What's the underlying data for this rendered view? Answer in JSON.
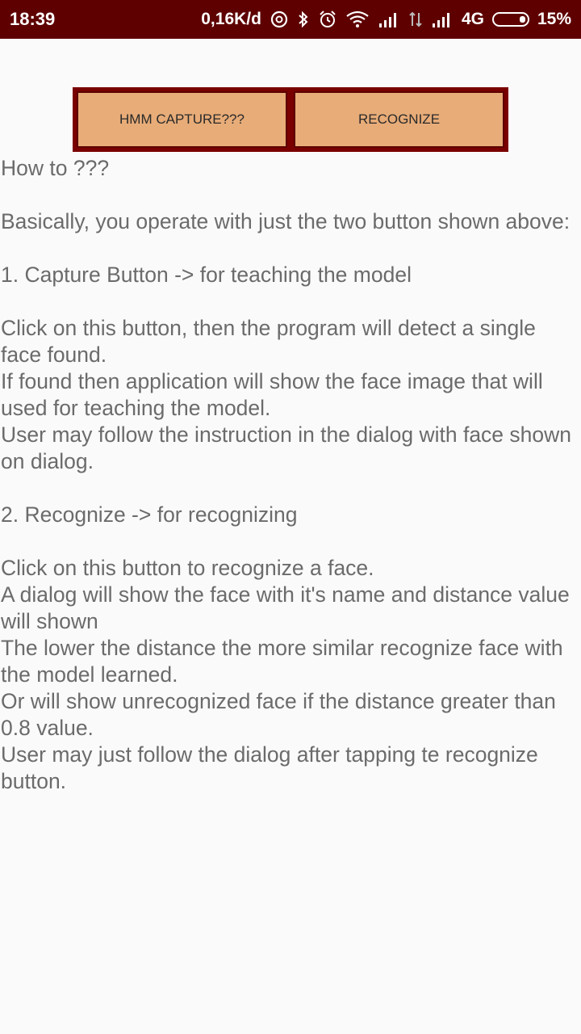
{
  "status_bar": {
    "time": "18:39",
    "network_speed": "0,16K/d",
    "icons": [
      "sync-icon",
      "bluetooth-icon",
      "alarm-icon",
      "wifi-icon",
      "signal-icon",
      "data-arrows-icon",
      "signal-icon"
    ],
    "network_type": "4G",
    "battery": "15%"
  },
  "buttons": {
    "capture_label": "HMM CAPTURE???",
    "recognize_label": "RECOGNIZE"
  },
  "instructions": {
    "text": "How to ???\n\nBasically, you operate with just the two button shown above:\n\n1. Capture Button -> for teaching the model\n\nClick on this button, then the program will detect a single face found.\nIf found then application will show the face image that will used for teaching the model.\nUser may follow the instruction in the dialog with face shown on dialog.\n\n2. Recognize -> for recognizing\n\nClick on this button to recognize a face.\nA dialog will show the face with it's name and distance value will shown\nThe lower the distance the more similar recognize face with the model learned.\nOr will show unrecognized face if the distance greater than 0.8 value.\nUser may just follow the dialog after tapping te recognize button."
  },
  "colors": {
    "status_bar": "#5e0000",
    "button_frame": "#7a0000",
    "button_fill": "#e8ac78",
    "text": "#6b6b6b",
    "background": "#fafafa"
  }
}
